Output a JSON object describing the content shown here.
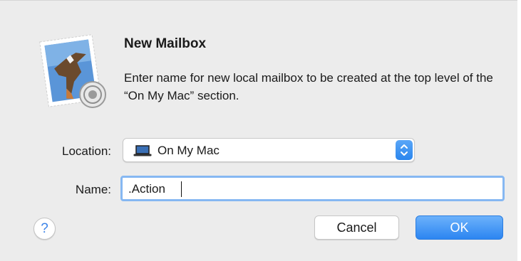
{
  "dialog": {
    "title": "New Mailbox",
    "message": "Enter name for new local mailbox to be created at the top level of the “On My Mac” section."
  },
  "form": {
    "location_label": "Location:",
    "location_value": "On My Mac",
    "name_label": "Name:",
    "name_value": ".Action"
  },
  "buttons": {
    "help": "?",
    "cancel": "Cancel",
    "ok": "OK"
  },
  "icons": {
    "app": "mail-stamp-eagle-icon",
    "location": "laptop-icon",
    "popup_arrows": "chevron-up-down-icon"
  },
  "colors": {
    "accent": "#2c85f1",
    "focus_ring": "#86b8f2",
    "dialog_bg": "#ececec"
  }
}
